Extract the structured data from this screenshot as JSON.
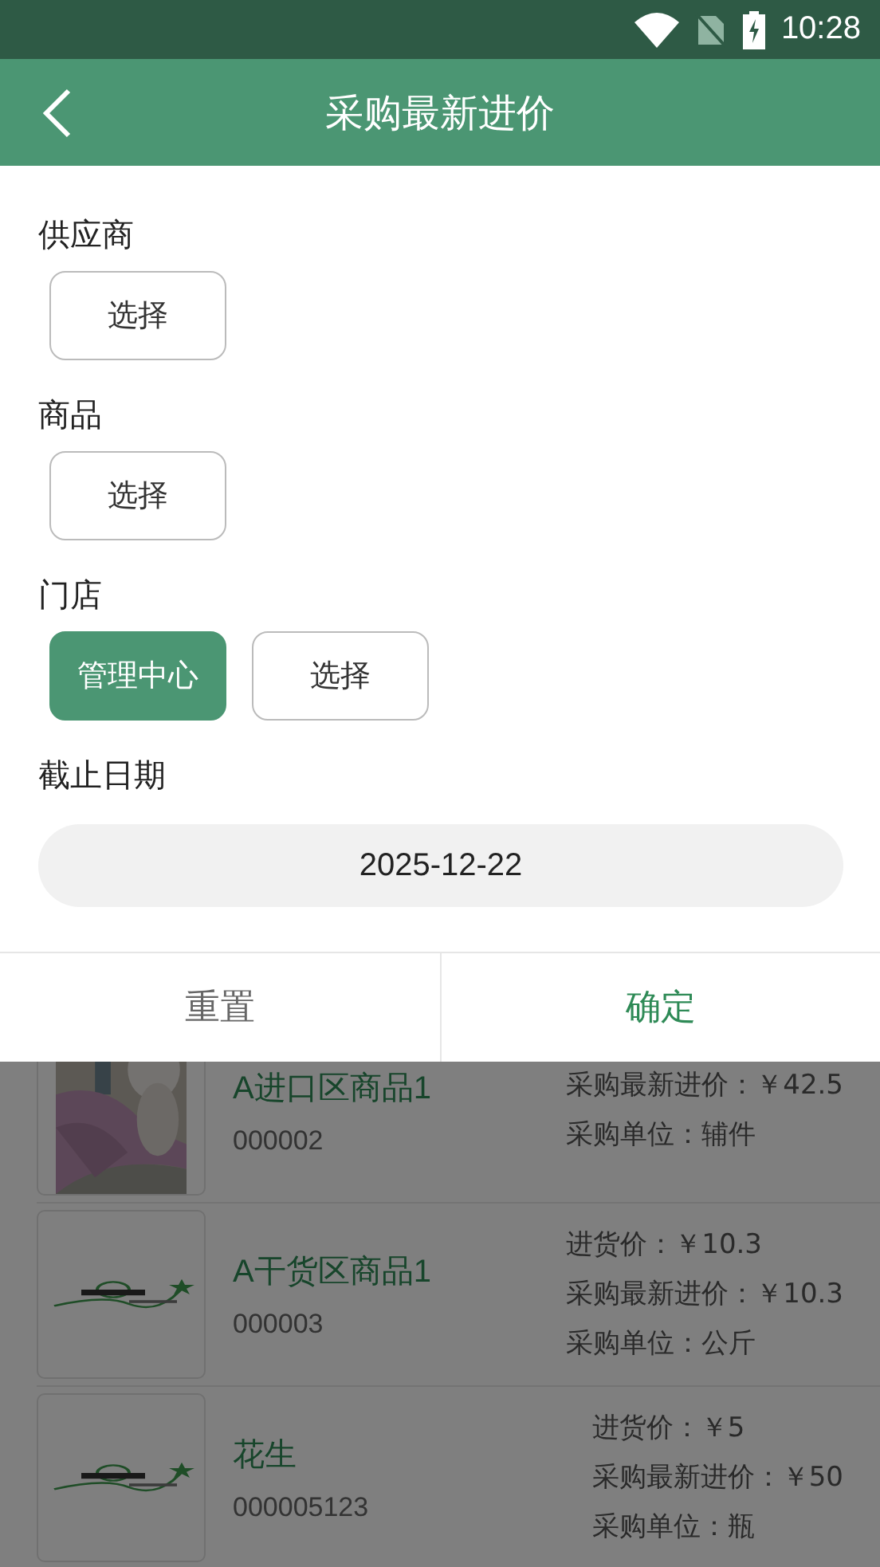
{
  "status_bar": {
    "time": "10:28"
  },
  "header": {
    "title": "采购最新进价"
  },
  "filters": [
    {
      "label": "供应商",
      "options": [
        {
          "text": "选择",
          "selected": false
        }
      ]
    },
    {
      "label": "商品",
      "options": [
        {
          "text": "选择",
          "selected": false
        }
      ]
    },
    {
      "label": "门店",
      "options": [
        {
          "text": "管理中心",
          "selected": true
        },
        {
          "text": "选择",
          "selected": false
        }
      ]
    }
  ],
  "date_filter": {
    "label": "截止日期",
    "value": "2025-12-22"
  },
  "actions": [
    {
      "label": "重置",
      "kind": "secondary"
    },
    {
      "label": "确定",
      "kind": "primary"
    }
  ],
  "products": [
    {
      "name": "A进口区商品1",
      "code": "000002",
      "details": [
        "采购最新进价：￥42.5",
        "采购单位：辅件"
      ]
    },
    {
      "name": "A干货区商品1",
      "code": "000003",
      "details": [
        "进货价：￥10.3",
        "采购最新进价：￥10.3",
        "采购单位：公斤"
      ]
    },
    {
      "name": "花生",
      "code": "000005123",
      "details": [
        "进货价：￥5",
        "采购最新进价：￥50",
        "采购单位：瓶"
      ]
    }
  ]
}
